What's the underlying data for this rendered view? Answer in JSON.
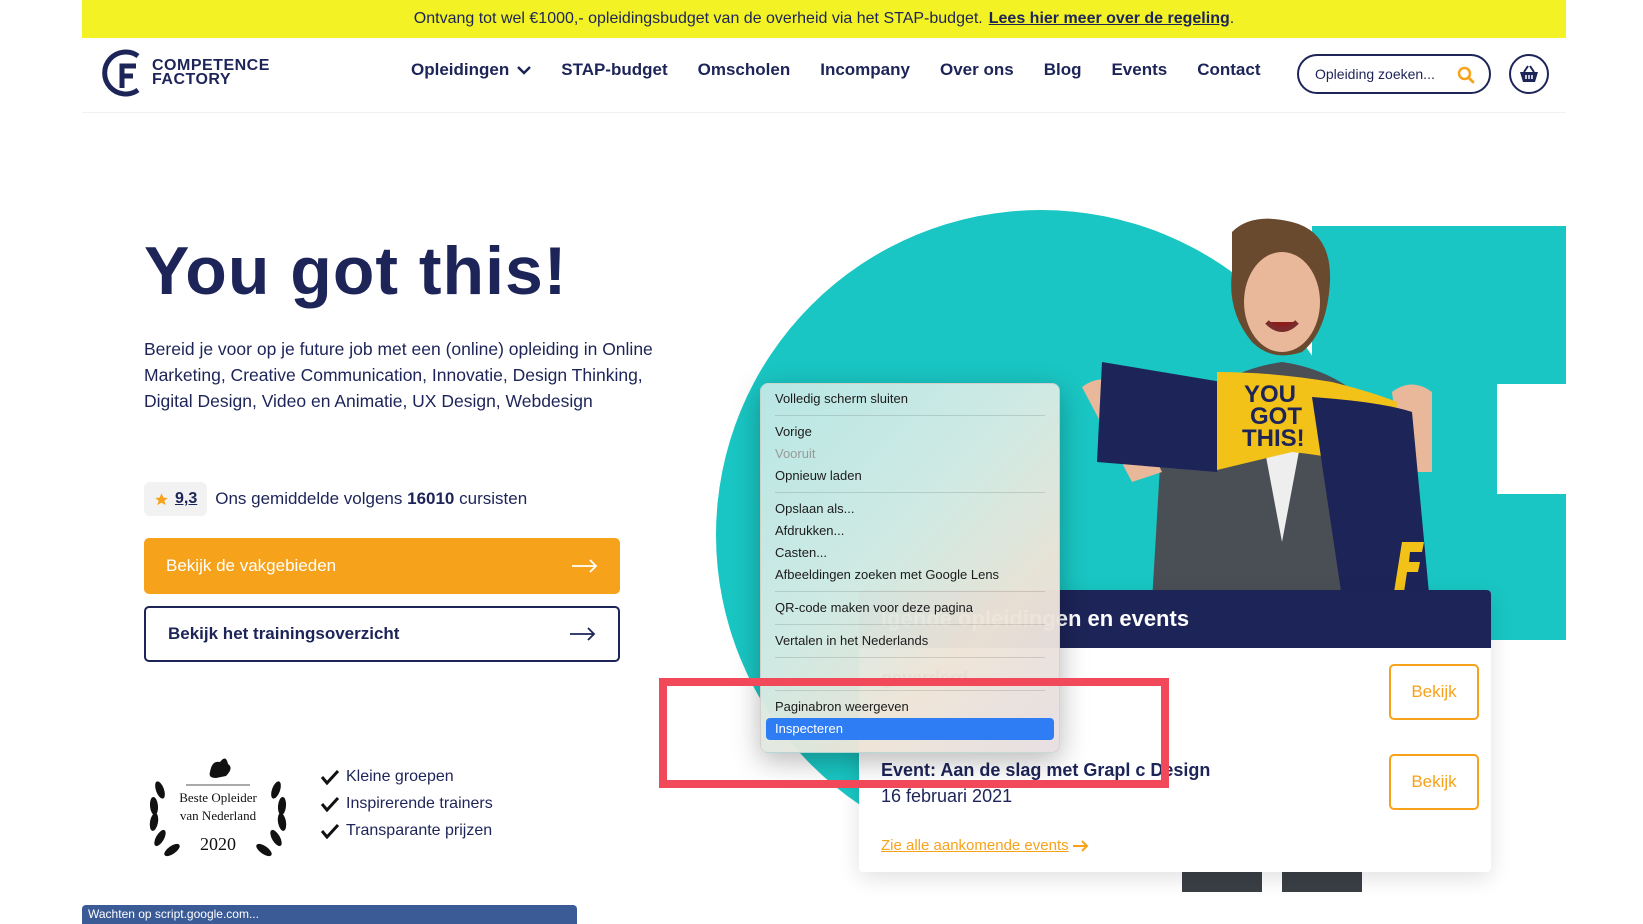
{
  "announcement": {
    "text": "Ontvang tot wel €1000,- opleidingsbudget van de overheid via het STAP-budget.",
    "link": "Lees hier meer over de regeling",
    "suffix": "."
  },
  "logo": {
    "line1": "COMPETENCE",
    "line2": "FACTORY"
  },
  "nav": {
    "items": [
      "Opleidingen",
      "STAP-budget",
      "Omscholen",
      "Incompany",
      "Over ons",
      "Blog",
      "Events",
      "Contact"
    ]
  },
  "search": {
    "placeholder": "Opleiding zoeken..."
  },
  "hero": {
    "title": "You got this!",
    "text": "Bereid je voor op je future job met een (online) opleiding in Online Marketing, Creative Communication, Innovatie, Design Thinking, Digital Design, Video en Animatie, UX Design, Webdesign",
    "rating": {
      "score": "9,3",
      "pre": "Ons gemiddelde volgens",
      "count": "16010",
      "post": "cursisten"
    },
    "btn_primary": "Bekijk de vakgebieden",
    "btn_secondary": "Bekijk het trainingsoverzicht"
  },
  "award": {
    "line1": "Beste Opleider",
    "line2": "van Nederland",
    "year": "2020"
  },
  "usps": [
    "Kleine groepen",
    "Inspirerende trainers",
    "Transparante prijzen"
  ],
  "scarf": {
    "line1": "YOU",
    "line2": "GOT",
    "line3": "THIS!"
  },
  "events": {
    "heading": "lgende opleidingen en events",
    "item1_title": "geverderd",
    "item2_title": "Event: Aan de slag met Grapl    c Design",
    "item2_date": "16 februari 2021",
    "button": "Bekijk",
    "all_link": "Zie alle aankomende events"
  },
  "context_menu": {
    "close_fullscreen": "Volledig scherm sluiten",
    "back": "Vorige",
    "forward": "Vooruit",
    "reload": "Opnieuw laden",
    "save_as": "Opslaan als...",
    "print": "Afdrukken...",
    "cast": "Casten...",
    "lens": "Afbeeldingen zoeken met Google Lens",
    "qr": "QR-code maken voor deze pagina",
    "translate": "Vertalen in het Nederlands",
    "view_source": "Paginabron weergeven",
    "inspect": "Inspecteren"
  },
  "status": {
    "text": "Wachten op script.google.com..."
  },
  "colors": {
    "navy": "#1d2458",
    "yellow": "#f2f224",
    "orange": "#f7a21b",
    "teal": "#19c6c3",
    "highlight": "#f2495a"
  }
}
